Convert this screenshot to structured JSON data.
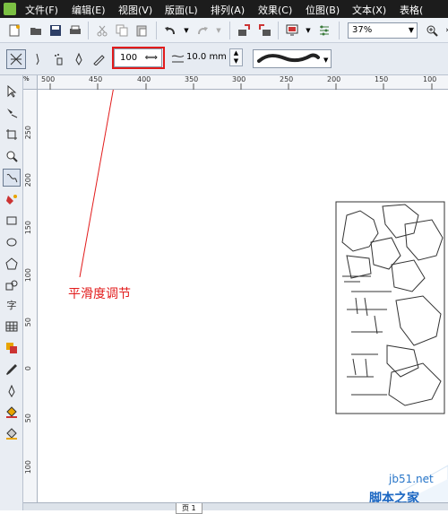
{
  "menubar": {
    "items": [
      "文件(F)",
      "编辑(E)",
      "视图(V)",
      "版面(L)",
      "排列(A)",
      "效果(C)",
      "位图(B)",
      "文本(X)",
      "表格("
    ]
  },
  "toolbar": {
    "zoom_value": "37%"
  },
  "propbar": {
    "smoothing_value": "100",
    "width_value": "10.0 mm"
  },
  "ruler": {
    "h_labels": [
      "500",
      "450",
      "400",
      "350",
      "300",
      "250",
      "200",
      "150",
      "100"
    ],
    "v_labels": [
      "250",
      "200",
      "150",
      "100",
      "50",
      "0",
      "50",
      "100"
    ],
    "corner": "%"
  },
  "toolbox": {
    "text_tool_label": "字"
  },
  "canvas": {
    "annotation": "平滑度调节",
    "watermark_url": "jb51.net",
    "watermark_site": "脚本之家"
  },
  "pagebar": {
    "page_label": "页 1"
  },
  "colors": {
    "annotation": "#e21b1b",
    "menubar_bg": "#1c1c1c",
    "watermark": "#1a66c2"
  }
}
